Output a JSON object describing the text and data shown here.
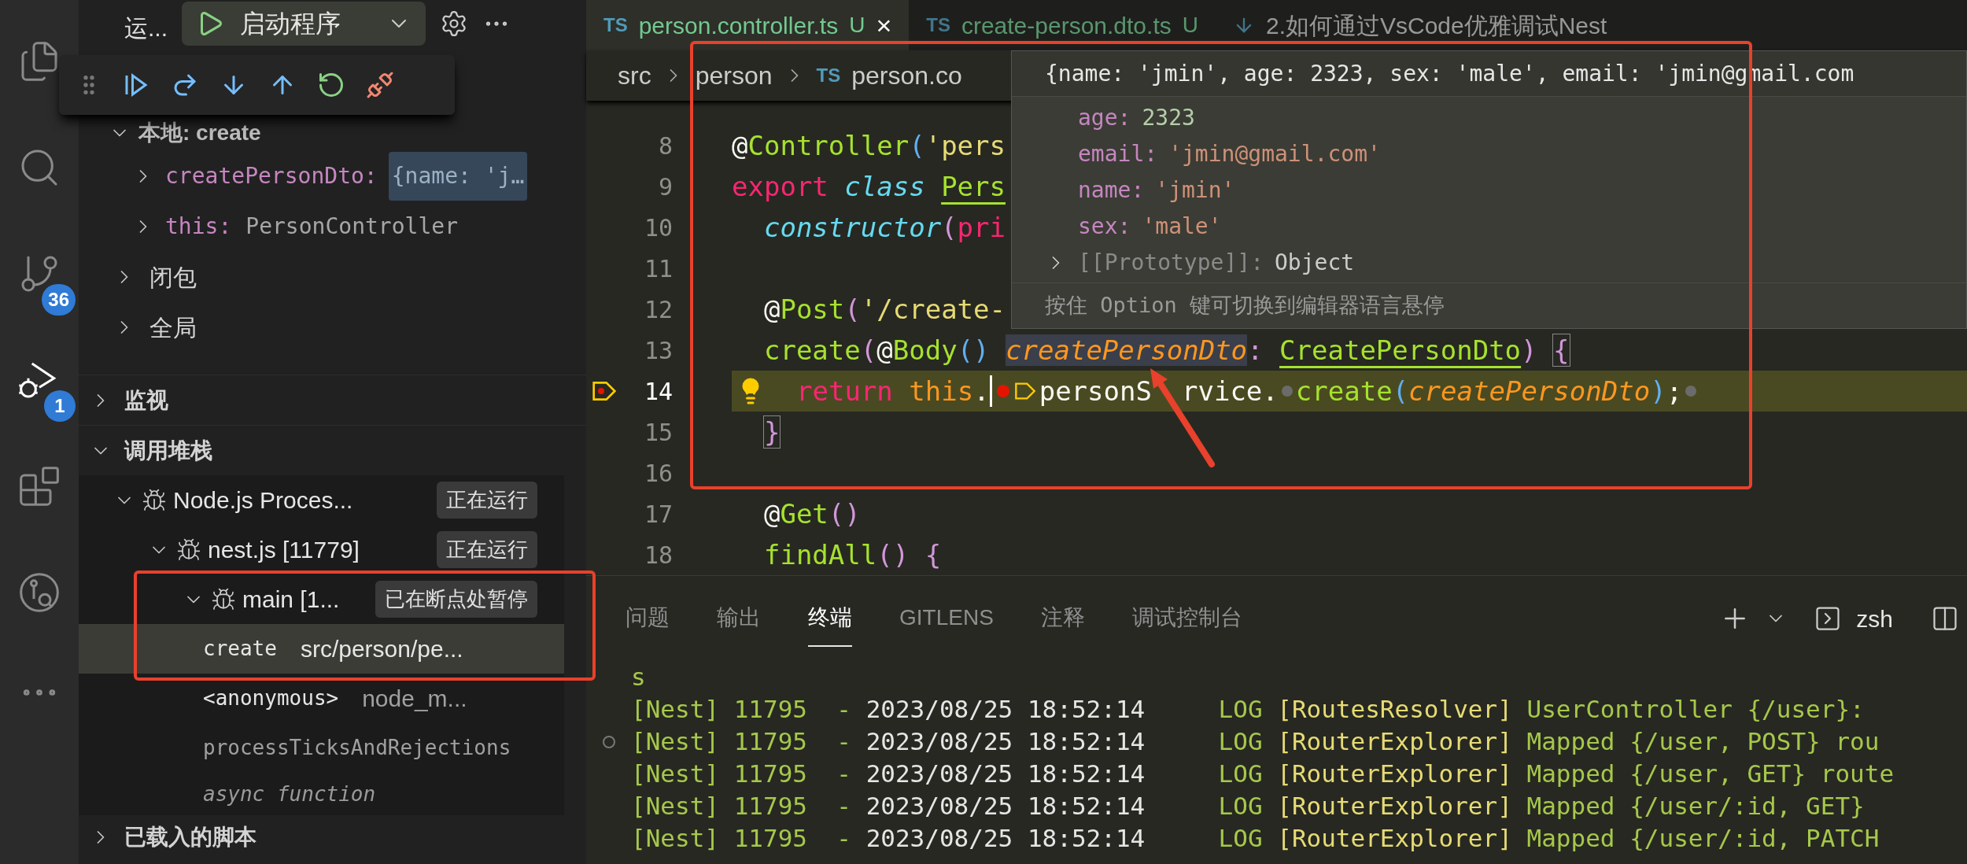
{
  "activity_bar": [
    {
      "kind": "files",
      "selected": false
    },
    {
      "kind": "search",
      "selected": false
    },
    {
      "kind": "source-control",
      "selected": false,
      "badge": "36"
    },
    {
      "kind": "debug",
      "selected": true,
      "badge": "1"
    },
    {
      "kind": "extensions",
      "selected": false
    },
    {
      "kind": "gitlens",
      "selected": false
    },
    {
      "kind": "more",
      "selected": false
    }
  ],
  "sidebar": {
    "title": "运...",
    "launch_config": "启动程序",
    "variables": {
      "scope": "本地: create",
      "expanded": true,
      "items": [
        {
          "name": "createPersonDto:",
          "value": "{name: 'j…",
          "selected": true,
          "expanded": false
        },
        {
          "name": "this:",
          "value": "PersonController",
          "selected": false,
          "expanded": false
        }
      ],
      "scopes": [
        {
          "label": "闭包",
          "expanded": false
        },
        {
          "label": "全局",
          "expanded": false
        }
      ]
    },
    "watch": {
      "label": "监视",
      "expanded": false
    },
    "call_stack": {
      "label": "调用堆栈",
      "expanded": true,
      "sessions": [
        {
          "label": "Node.js Proces...",
          "status": "正在运行",
          "expanded": true,
          "children": [
            {
              "label": "nest.js [11779]",
              "status": "正在运行",
              "expanded": true,
              "children": [
                {
                  "label": "main [1...",
                  "status": "已在断点处暂停",
                  "expanded": true,
                  "frames": [
                    {
                      "kind": "frame",
                      "function": "create",
                      "source": "src/person/pe...",
                      "selected": true
                    },
                    {
                      "kind": "frame",
                      "function": "<anonymous>",
                      "source": "node_m...",
                      "selected": false
                    },
                    {
                      "kind": "internal",
                      "function": "processTicksAndRejections",
                      "selected": false
                    },
                    {
                      "kind": "async",
                      "function": "async function",
                      "selected": false
                    }
                  ]
                }
              ]
            }
          ]
        }
      ]
    },
    "loaded_scripts": {
      "label": "已载入的脚本",
      "expanded": false
    }
  },
  "editor": {
    "tabs": [
      {
        "label": "person.controller.ts",
        "status": "U",
        "kind": "ts",
        "icon_text": "TS",
        "close": "×",
        "selected": true
      },
      {
        "label": "create-person.dto.ts",
        "status": "U",
        "kind": "ts",
        "icon_text": "TS",
        "selected": false
      },
      {
        "label": "2.如何通过VsCode优雅调试Nest",
        "kind": "md",
        "selected": false
      }
    ],
    "breadcrumbs": [
      {
        "label": "src",
        "kind": "folder"
      },
      {
        "label": "person",
        "kind": "folder"
      },
      {
        "label": "person.co",
        "kind": "ts",
        "icon_text": "TS"
      }
    ],
    "lines": [
      {
        "number": "8",
        "current": false,
        "tokens": [
          {
            "kind": "plain",
            "t": "@"
          },
          {
            "kind": "fn",
            "t": "Controller"
          },
          {
            "kind": "paren2",
            "t": "("
          },
          {
            "kind": "string",
            "t": "'pers"
          }
        ]
      },
      {
        "number": "9",
        "current": false,
        "tokens": [
          {
            "kind": "keyword",
            "t": "export "
          },
          {
            "kind": "storage",
            "t": "class "
          },
          {
            "kind": "type",
            "t": "Pers"
          }
        ]
      },
      {
        "number": "10",
        "current": false,
        "tokens": [
          {
            "kind": "storage",
            "t": "  constructor"
          },
          {
            "kind": "paren",
            "t": "("
          },
          {
            "kind": "keyword",
            "t": "pri"
          }
        ]
      },
      {
        "number": "11",
        "current": false
      },
      {
        "number": "12",
        "current": false,
        "tokens": [
          {
            "kind": "plain",
            "t": "  @"
          },
          {
            "kind": "fn",
            "t": "Post"
          },
          {
            "kind": "paren",
            "t": "("
          },
          {
            "kind": "string",
            "t": "'/create-"
          }
        ]
      },
      {
        "number": "13",
        "current": false,
        "tokens": [
          {
            "kind": "fn",
            "t": "  create"
          },
          {
            "kind": "paren",
            "t": "("
          },
          {
            "kind": "plain",
            "t": "@"
          },
          {
            "kind": "fn",
            "t": "Body"
          },
          {
            "kind": "paren2",
            "t": "() "
          },
          {
            "kind": "param-hover",
            "t": "createPersonDto"
          },
          {
            "kind": "paren",
            "t": ": "
          },
          {
            "kind": "type",
            "t": "CreatePersonDto"
          },
          {
            "kind": "paren",
            "t": ") "
          },
          {
            "kind": "bracket-match",
            "t": "{"
          }
        ]
      },
      {
        "number": "14",
        "current": true,
        "tokens": [
          {
            "kind": "keyword",
            "t": "return "
          },
          {
            "kind": "this",
            "t": "this"
          },
          {
            "kind": "plain",
            "t": "."
          },
          {
            "kind": "cursor"
          },
          {
            "kind": "bp-active"
          },
          {
            "kind": "bp-stop"
          },
          {
            "kind": "plain",
            "t": "personS"
          },
          {
            "kind": "gap"
          },
          {
            "kind": "plain",
            "t": "rvice."
          },
          {
            "kind": "bp-hollow"
          },
          {
            "kind": "fn",
            "t": "create"
          },
          {
            "kind": "paren2",
            "t": "("
          },
          {
            "kind": "param",
            "t": "createPersonDto"
          },
          {
            "kind": "paren2",
            "t": ")"
          },
          {
            "kind": "plain",
            "t": ";"
          },
          {
            "kind": "bp-hollow"
          }
        ]
      },
      {
        "number": "15",
        "current": false,
        "tokens": [
          {
            "kind": "bracket-match",
            "t": "  }"
          }
        ]
      },
      {
        "number": "16",
        "current": false
      },
      {
        "number": "17",
        "current": false,
        "tokens": [
          {
            "kind": "plain",
            "t": "  @"
          },
          {
            "kind": "fn",
            "t": "Get"
          },
          {
            "kind": "paren",
            "t": "()"
          }
        ]
      },
      {
        "number": "18",
        "current": false,
        "tokens": [
          {
            "kind": "fn",
            "t": "  findAll"
          },
          {
            "kind": "paren",
            "t": "() {"
          }
        ]
      }
    ],
    "hover": {
      "summary": "{name: 'jmin', age: 2323, sex: 'male', email: 'jmin@gmail.com",
      "properties": [
        {
          "key": "age:",
          "value": "2323",
          "kind": "number"
        },
        {
          "key": "email:",
          "value": "'jmin@gmail.com'",
          "kind": "string"
        },
        {
          "key": "name:",
          "value": "'jmin'",
          "kind": "string"
        },
        {
          "key": "sex:",
          "value": "'male'",
          "kind": "string"
        },
        {
          "key": "[[Prototype]]:",
          "value": "Object",
          "kind": "object"
        }
      ],
      "footer": "按住 Option 键可切换到编辑器语言悬停"
    }
  },
  "panel": {
    "tabs": [
      {
        "label": "问题",
        "selected": false
      },
      {
        "label": "输出",
        "selected": false
      },
      {
        "label": "终端",
        "selected": true
      },
      {
        "label": "GITLENS",
        "selected": false
      },
      {
        "label": "注释",
        "selected": false
      },
      {
        "label": "调试控制台",
        "selected": false
      }
    ],
    "shell": "zsh",
    "terminal": [
      {
        "tokens": [
          {
            "kind": "prefix",
            "t": "s"
          }
        ]
      },
      {
        "tokens": [
          {
            "kind": "prefix",
            "t": "[Nest] 11795  - "
          },
          {
            "kind": "time",
            "t": "2023/08/25 18:52:14"
          },
          {
            "kind": "prefix",
            "t": "     LOG "
          },
          {
            "kind": "context",
            "t": "[RoutesResolver] "
          },
          {
            "kind": "prefix",
            "t": "UserController {/user}:"
          }
        ]
      },
      {
        "tokens": [
          {
            "kind": "prefix",
            "t": "[Nest] 11795  - "
          },
          {
            "kind": "time",
            "t": "2023/08/25 18:52:14"
          },
          {
            "kind": "prefix",
            "t": "     LOG "
          },
          {
            "kind": "context",
            "t": "[RouterExplorer] "
          },
          {
            "kind": "prefix",
            "t": "Mapped {/user, POST} rou"
          }
        ]
      },
      {
        "tokens": [
          {
            "kind": "prefix",
            "t": "[Nest] 11795  - "
          },
          {
            "kind": "time",
            "t": "2023/08/25 18:52:14"
          },
          {
            "kind": "prefix",
            "t": "     LOG "
          },
          {
            "kind": "context",
            "t": "[RouterExplorer] "
          },
          {
            "kind": "prefix",
            "t": "Mapped {/user, GET} route"
          }
        ]
      },
      {
        "tokens": [
          {
            "kind": "prefix",
            "t": "[Nest] 11795  - "
          },
          {
            "kind": "time",
            "t": "2023/08/25 18:52:14"
          },
          {
            "kind": "prefix",
            "t": "     LOG "
          },
          {
            "kind": "context",
            "t": "[RouterExplorer] "
          },
          {
            "kind": "prefix",
            "t": "Mapped {/user/:id, GET}"
          }
        ]
      },
      {
        "tokens": [
          {
            "kind": "prefix",
            "t": "[Nest] 11795  - "
          },
          {
            "kind": "time",
            "t": "2023/08/25 18:52:14"
          },
          {
            "kind": "prefix",
            "t": "     LOG "
          },
          {
            "kind": "context",
            "t": "[RouterExplorer] "
          },
          {
            "kind": "prefix",
            "t": "Mapped {/user/:id, PATCH"
          }
        ]
      }
    ]
  }
}
